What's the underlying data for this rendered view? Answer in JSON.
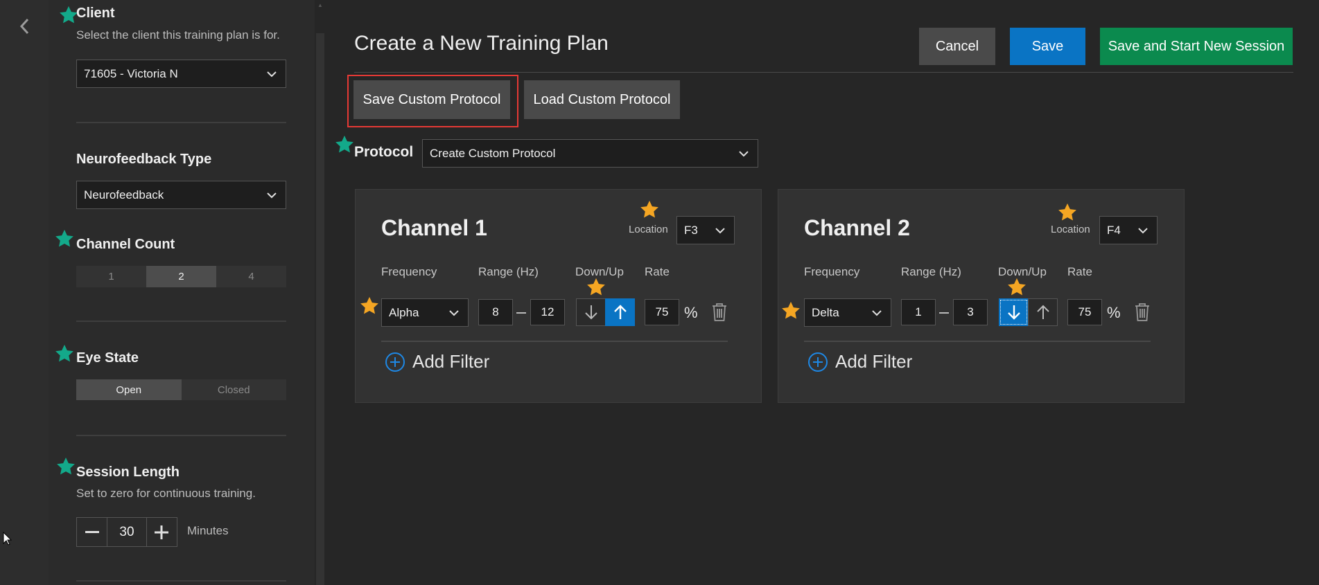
{
  "sidebar": {
    "client": {
      "title": "Client",
      "description": "Select the client this training plan is for.",
      "value": "71605 - Victoria N"
    },
    "neurofeedback_type": {
      "title": "Neurofeedback Type",
      "value": "Neurofeedback"
    },
    "channel_count": {
      "title": "Channel Count",
      "options": [
        "1",
        "2",
        "4"
      ],
      "selected": "2"
    },
    "eye_state": {
      "title": "Eye State",
      "options": [
        "Open",
        "Closed"
      ],
      "selected": "Open"
    },
    "session_length": {
      "title": "Session Length",
      "description": "Set to zero for continuous training.",
      "value": "30",
      "unit": "Minutes"
    }
  },
  "header": {
    "title": "Create a New Training Plan",
    "cancel_label": "Cancel",
    "save_label": "Save",
    "save_start_label": "Save and Start New Session"
  },
  "toolbar": {
    "save_custom_label": "Save Custom Protocol",
    "load_custom_label": "Load Custom Protocol"
  },
  "protocol": {
    "label": "Protocol",
    "value": "Create Custom Protocol"
  },
  "columns": {
    "frequency": "Frequency",
    "range": "Range (Hz)",
    "direction": "Down/Up",
    "rate": "Rate"
  },
  "channels": [
    {
      "title": "Channel 1",
      "location_label": "Location",
      "location": "F3",
      "frequency": "Alpha",
      "range_low": "8",
      "range_high": "12",
      "direction": "up",
      "rate": "75",
      "rate_unit": "%",
      "add_filter_label": "Add Filter"
    },
    {
      "title": "Channel 2",
      "location_label": "Location",
      "location": "F4",
      "frequency": "Delta",
      "range_low": "1",
      "range_high": "3",
      "direction": "down",
      "rate": "75",
      "rate_unit": "%",
      "add_filter_label": "Add Filter"
    }
  ],
  "colors": {
    "accent_blue": "#0a74c4",
    "success_green": "#0b8a4e",
    "highlight_red": "#e53935",
    "star_teal": "#13a98a",
    "star_gold": "#f5a623"
  },
  "icons": [
    "back-chevron-icon",
    "chevron-down-icon",
    "arrow-down-icon",
    "arrow-up-icon",
    "trash-icon",
    "add-circle-icon",
    "minus-icon",
    "plus-icon",
    "star-icon",
    "mouse-cursor-icon"
  ]
}
